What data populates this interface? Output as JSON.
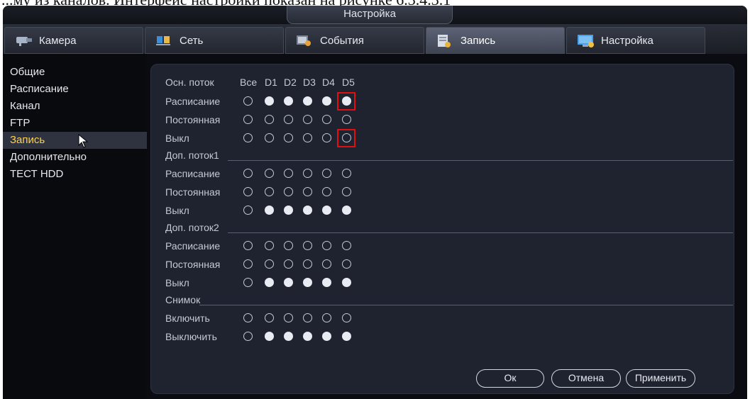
{
  "doc_caption": "...му из каналов. Интерфейс настройки показан на рисунке 6.3.4.3.1",
  "window": {
    "title": "Настройка"
  },
  "tabs": [
    {
      "label": "Камера",
      "icon": "camera-icon"
    },
    {
      "label": "Сеть",
      "icon": "network-icon"
    },
    {
      "label": "События",
      "icon": "events-icon"
    },
    {
      "label": "Запись",
      "icon": "record-icon",
      "active": true
    },
    {
      "label": "Настройка",
      "icon": "settings-monitor-icon"
    }
  ],
  "sidebar": {
    "items": [
      {
        "label": "Общие"
      },
      {
        "label": "Расписание"
      },
      {
        "label": "Канал"
      },
      {
        "label": "FTP"
      },
      {
        "label": "Запись",
        "active": true
      },
      {
        "label": "Дополнительно"
      },
      {
        "label": "ТЕСТ HDD"
      }
    ]
  },
  "panel": {
    "main_header": {
      "title": "Осн. поток",
      "all_label": "Все",
      "channels": [
        "D1",
        "D2",
        "D3",
        "D4",
        "D5"
      ]
    },
    "main_rows": [
      {
        "label": "Расписание",
        "all": false,
        "ch": [
          true,
          true,
          true,
          true,
          true
        ],
        "highlight_d5": true
      },
      {
        "label": "Постоянная",
        "all": false,
        "ch": [
          false,
          false,
          false,
          false,
          false
        ]
      },
      {
        "label": "Выкл",
        "all": false,
        "ch": [
          false,
          false,
          false,
          false,
          false
        ],
        "highlight_d5": true
      }
    ],
    "extra1": {
      "title": "Доп. поток1",
      "rows": [
        {
          "label": "Расписание",
          "all": false,
          "ch": [
            false,
            false,
            false,
            false,
            false
          ]
        },
        {
          "label": "Постоянная",
          "all": false,
          "ch": [
            false,
            false,
            false,
            false,
            false
          ]
        },
        {
          "label": "Выкл",
          "all": false,
          "ch": [
            true,
            true,
            true,
            true,
            true
          ]
        }
      ]
    },
    "extra2": {
      "title": "Доп. поток2",
      "rows": [
        {
          "label": "Расписание",
          "all": false,
          "ch": [
            false,
            false,
            false,
            false,
            false
          ]
        },
        {
          "label": "Постоянная",
          "all": false,
          "ch": [
            false,
            false,
            false,
            false,
            false
          ]
        },
        {
          "label": "Выкл",
          "all": false,
          "ch": [
            true,
            true,
            true,
            true,
            true
          ]
        }
      ]
    },
    "snapshot": {
      "title": "Снимок",
      "rows": [
        {
          "label": "Включить",
          "all": false,
          "ch": [
            false,
            false,
            false,
            false,
            false
          ]
        },
        {
          "label": "Выключить",
          "all": false,
          "ch": [
            true,
            true,
            true,
            true,
            true
          ]
        }
      ]
    }
  },
  "buttons": {
    "ok": "Ок",
    "cancel": "Отмена",
    "apply": "Применить"
  },
  "colors": {
    "highlight": "#e01010",
    "active_sidebar_text": "#ffd24a"
  }
}
